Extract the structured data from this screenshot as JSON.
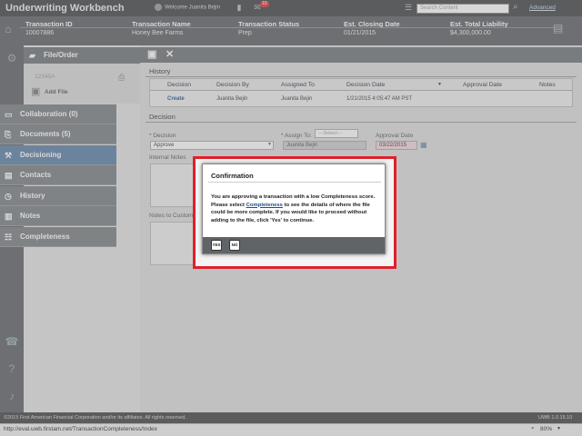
{
  "app": {
    "title": "Underwriting Workbench",
    "welcome": "Welcome Juanita Bejin",
    "notif_count": "10",
    "search_placeholder": "Search Content",
    "advanced": "Advanced"
  },
  "info": {
    "headers": [
      "Transaction ID",
      "Transaction Name",
      "Transaction Status",
      "Est. Closing Date",
      "Est. Total Liability"
    ],
    "values": [
      "10007886",
      "Honey Bee Farms",
      "Prep",
      "01/21/2015",
      "$4,300,000.00"
    ]
  },
  "sidebar": {
    "file_order": "File/Order",
    "file_number": "12345A",
    "add_file": "Add File",
    "items": [
      {
        "label": "Collaboration (0)",
        "icon": "chat-icon"
      },
      {
        "label": "Documents (5)",
        "icon": "paperclip-icon"
      },
      {
        "label": "Decisioning",
        "icon": "gavel-icon"
      },
      {
        "label": "Contacts",
        "icon": "contacts-icon"
      },
      {
        "label": "History",
        "icon": "clock-icon"
      },
      {
        "label": "Notes",
        "icon": "notes-icon"
      },
      {
        "label": "Completeness",
        "icon": "checklist-icon"
      }
    ]
  },
  "history": {
    "title": "History",
    "columns": [
      "Decision",
      "Decision By",
      "Assigned To",
      "Decision Date",
      "Approval Date",
      "Notes"
    ],
    "row": {
      "decision": "Create",
      "by": "Juanita Bejin",
      "assigned": "Juanita Bejin",
      "date": "1/21/2015 4:05:47 AM PST"
    }
  },
  "decision": {
    "title": "Decision",
    "decision_label": "* Decision",
    "decision_value": "Approve",
    "assign_label": "* Assign To:",
    "assign_select": "---Select---",
    "assign_value": "Juanita Bejin",
    "approval_label": "Approval Date",
    "approval_value": "03/22/2015",
    "internal_notes": "Internal Notes",
    "notes_customer": "Notes to Custome"
  },
  "dialog": {
    "title": "Confirmation",
    "body_1": "You are approving a transaction with a low Completeness score. Please select ",
    "link": "Completeness",
    "body_2": " to see the details of where the file could be more complete. If you would like to proceed without adding to the file, click 'Yes' to continue.",
    "yes": "YES",
    "no": "NO"
  },
  "footer": {
    "copyright": "©2015 First American Financial Corporation and/or its affiliates. All rights reserved.",
    "version": "UWB 1.0.15.10"
  },
  "status": {
    "url": "http://eval.uwb.firstam.net/TransactionCompleteness/Index",
    "zoom": "80%"
  }
}
